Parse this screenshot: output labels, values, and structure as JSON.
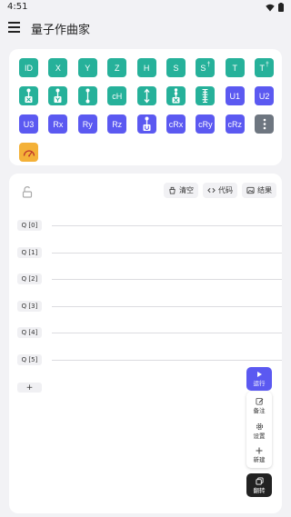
{
  "status": {
    "time": "4:51"
  },
  "app": {
    "title": "量子作曲家"
  },
  "gates": [
    {
      "label": "ID",
      "sup": "",
      "color": "teal",
      "icon": ""
    },
    {
      "label": "X",
      "sup": "",
      "color": "teal",
      "icon": ""
    },
    {
      "label": "Y",
      "sup": "",
      "color": "teal",
      "icon": ""
    },
    {
      "label": "Z",
      "sup": "",
      "color": "teal",
      "icon": ""
    },
    {
      "label": "H",
      "sup": "",
      "color": "teal",
      "icon": ""
    },
    {
      "label": "S",
      "sup": "",
      "color": "teal",
      "icon": ""
    },
    {
      "label": "S",
      "sup": "†",
      "color": "teal",
      "icon": ""
    },
    {
      "label": "T",
      "sup": "",
      "color": "teal",
      "icon": ""
    },
    {
      "label": "T",
      "sup": "†",
      "color": "teal",
      "icon": ""
    },
    {
      "label": "",
      "sup": "",
      "color": "teal",
      "icon": "cx-gate-icon"
    },
    {
      "label": "",
      "sup": "",
      "color": "teal",
      "icon": "cy-gate-icon"
    },
    {
      "label": "",
      "sup": "",
      "color": "teal",
      "icon": "cz-gate-icon"
    },
    {
      "label": "cH",
      "sup": "",
      "color": "teal",
      "icon": ""
    },
    {
      "label": "",
      "sup": "",
      "color": "teal",
      "icon": "swap-gate-icon"
    },
    {
      "label": "",
      "sup": "",
      "color": "teal",
      "icon": "ccx-gate-icon"
    },
    {
      "label": "",
      "sup": "",
      "color": "teal",
      "icon": "multi-control-gate-icon"
    },
    {
      "label": "U1",
      "sup": "",
      "color": "purple",
      "icon": ""
    },
    {
      "label": "U2",
      "sup": "",
      "color": "purple",
      "icon": ""
    },
    {
      "label": "U3",
      "sup": "",
      "color": "purple",
      "icon": ""
    },
    {
      "label": "Rx",
      "sup": "",
      "color": "purple",
      "icon": ""
    },
    {
      "label": "Ry",
      "sup": "",
      "color": "purple",
      "icon": ""
    },
    {
      "label": "Rz",
      "sup": "",
      "color": "purple",
      "icon": ""
    },
    {
      "label": "",
      "sup": "",
      "color": "purple",
      "icon": "cu-gate-icon"
    },
    {
      "label": "cRx",
      "sup": "",
      "color": "purple",
      "icon": ""
    },
    {
      "label": "cRy",
      "sup": "",
      "color": "purple",
      "icon": ""
    },
    {
      "label": "cRz",
      "sup": "",
      "color": "purple",
      "icon": ""
    },
    {
      "label": "",
      "sup": "",
      "color": "gray",
      "icon": "more-vertical-icon"
    },
    {
      "label": "",
      "sup": "",
      "color": "orange",
      "icon": "measure-gauge-icon"
    }
  ],
  "toolbar": {
    "clear_label": "清空",
    "code_label": "代码",
    "result_label": "结果"
  },
  "qubits": [
    "Q [0]",
    "Q [1]",
    "Q [2]",
    "Q [3]",
    "Q [4]",
    "Q [5]"
  ],
  "add_qubit_label": "+",
  "actions": {
    "run_label": "运行",
    "note_label": "备注",
    "settings_label": "设置",
    "new_label": "新建",
    "flip_label": "翻转"
  },
  "colors": {
    "teal": "#26b19a",
    "purple": "#5b59f1",
    "gray": "#6e7680",
    "orange": "#f4b138"
  }
}
